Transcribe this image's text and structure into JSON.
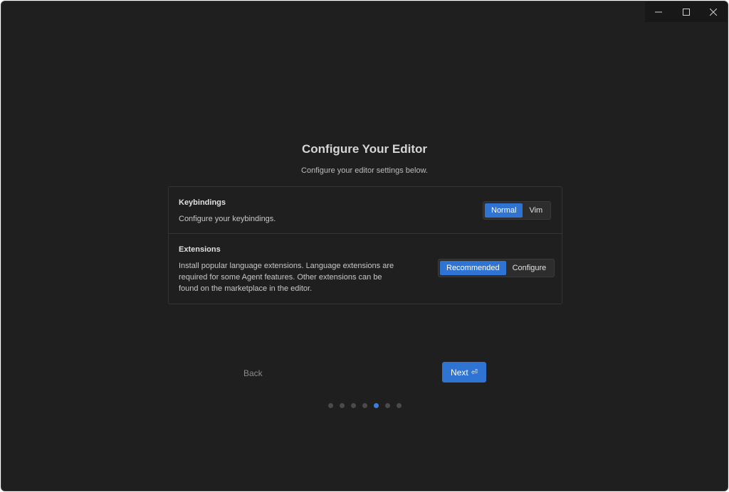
{
  "window": {
    "controls": {
      "minimize": "minimize-icon",
      "maximize": "maximize-icon",
      "close": "close-icon"
    }
  },
  "header": {
    "title": "Configure Your Editor",
    "subtitle": "Configure your editor settings below."
  },
  "settings": {
    "keybindings": {
      "title": "Keybindings",
      "description": "Configure your keybindings.",
      "options": [
        "Normal",
        "Vim"
      ],
      "selected": "Normal"
    },
    "extensions": {
      "title": "Extensions",
      "description": "Install popular language extensions. Language extensions are required for some Agent features. Other extensions can be found on the marketplace in the editor.",
      "options": [
        "Recommended",
        "Configure"
      ],
      "selected": "Recommended"
    }
  },
  "footer": {
    "back_label": "Back",
    "next_label": "Next",
    "next_icon": "⏎"
  },
  "progress": {
    "total_steps": 7,
    "current_step": 5
  },
  "colors": {
    "accent": "#2f74d3",
    "background": "#1f1f1f",
    "border": "#343434"
  }
}
